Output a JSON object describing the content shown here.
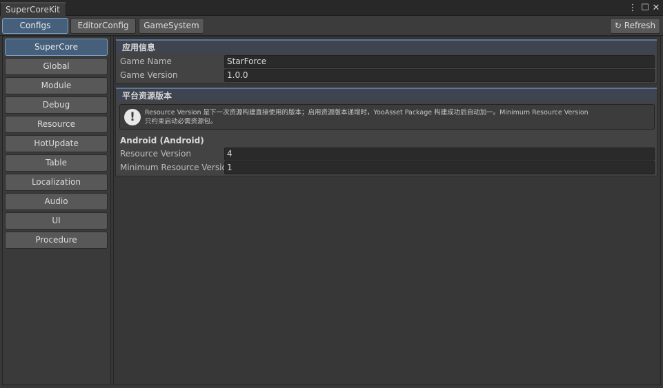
{
  "window": {
    "tab_title": "SuperCoreKit",
    "menu_icon": "⋮",
    "maximize_icon": "☐",
    "close_icon": "✕"
  },
  "toolbar": {
    "tabs": [
      "Configs",
      "EditorConfig",
      "GameSystem"
    ],
    "active_tab": "Configs",
    "refresh_icon": "↻",
    "refresh_label": "Refresh"
  },
  "sidebar": {
    "items": [
      "SuperCore",
      "Global",
      "Module",
      "Debug",
      "Resource",
      "HotUpdate",
      "Table",
      "Localization",
      "Audio",
      "UI",
      "Procedure"
    ],
    "active_item": "SuperCore"
  },
  "app_info": {
    "title": "应用信息",
    "game_name_label": "Game Name",
    "game_name_value": "StarForce",
    "game_version_label": "Game Version",
    "game_version_value": "1.0.0"
  },
  "platform": {
    "title": "平台资源版本",
    "help_icon": "!",
    "help_line1": "Resource Version 是下一次资源构建直接使用的版本；启用资源版本递增时，YooAsset Package 构建成功后自动加一。Minimum Resource Version",
    "help_line2": "只约束启动必需资源包。",
    "android_heading": "Android (Android)",
    "resource_version_label": "Resource Version",
    "resource_version_value": "4",
    "min_resource_version_label": "Minimum Resource Version",
    "min_resource_version_value": "1"
  },
  "colors": {
    "accent": "#46607c",
    "accent_border": "#7ca1c8",
    "background": "#383838"
  }
}
